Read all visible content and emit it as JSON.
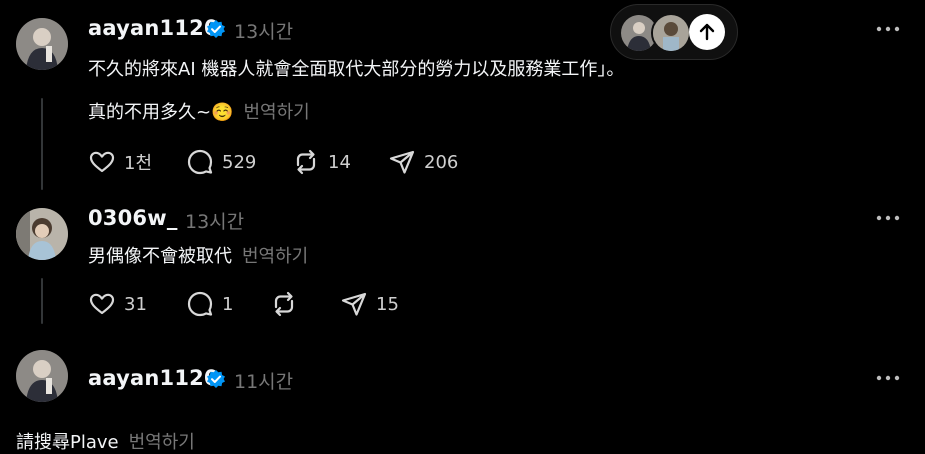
{
  "posts": [
    {
      "username": "aayan1120",
      "verified": true,
      "time": "13시간",
      "lines": [
        "不久的將來AI 機器人就會全面取代大部分的勞力以及服務業工作」。",
        "真的不用多久~☺️"
      ],
      "translate": "번역하기",
      "likes": "1천",
      "replies": "529",
      "reposts": "14",
      "shares": "206"
    },
    {
      "username": "0306w_",
      "verified": false,
      "time": "13시간",
      "lines": [
        "男偶像不會被取代"
      ],
      "translate": "번역하기",
      "likes": "31",
      "replies": "1",
      "reposts": "",
      "shares": "15"
    },
    {
      "username": "aayan1120",
      "verified": true,
      "time": "11시간",
      "lines": [
        "請搜尋Plave"
      ],
      "translate": "번역하기"
    }
  ],
  "icons": {
    "like": "heart-icon",
    "reply": "comment-icon",
    "repost": "repost-icon",
    "share": "send-icon",
    "more": "more-icon",
    "scroll_top": "arrow-up-icon",
    "verified": "verified-badge-icon"
  },
  "colors": {
    "background": "#000000",
    "text": "#f3f5f7",
    "muted": "#777777",
    "verified": "#0095f6"
  }
}
